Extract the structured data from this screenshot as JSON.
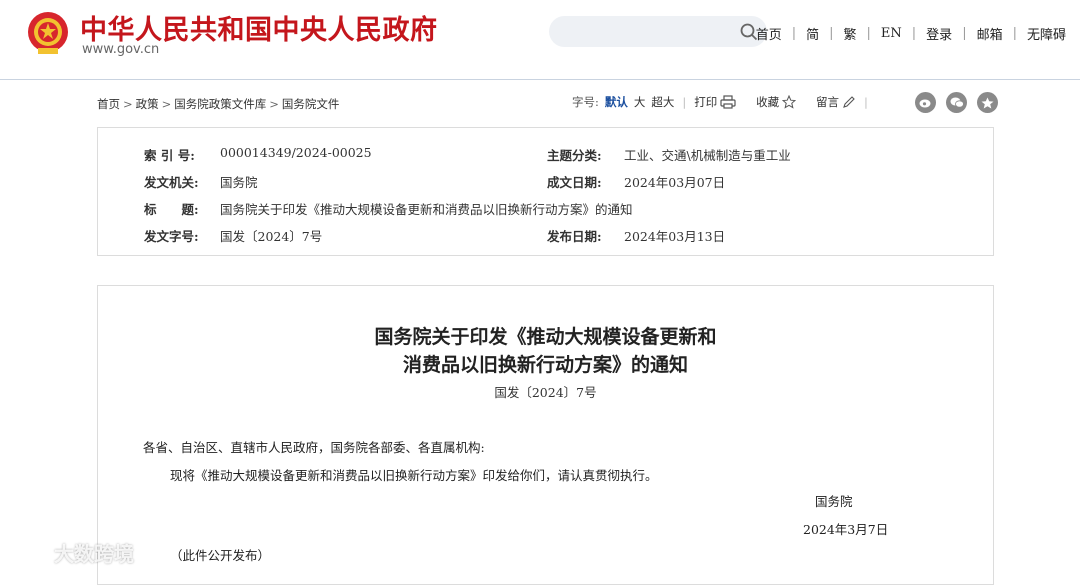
{
  "header": {
    "site_title": "中华人民共和国中央人民政府",
    "site_domain": "www.gov.cn",
    "search_placeholder": "",
    "nav": [
      {
        "label": "首页"
      },
      {
        "label": "简"
      },
      {
        "label": "繁"
      },
      {
        "label": "EN"
      },
      {
        "label": "登录"
      },
      {
        "label": "邮箱"
      },
      {
        "label": "无障碍"
      }
    ]
  },
  "breadcrumb": [
    "首页",
    "政策",
    "国务院政策文件库",
    "国务院文件"
  ],
  "tools": {
    "font_size_label": "字号:",
    "font_default": "默认",
    "font_large": "大",
    "font_xlarge": "超大",
    "print": "打印",
    "favorite": "收藏",
    "comment": "留言"
  },
  "share_icons": [
    "weibo-icon",
    "wechat-icon",
    "qzone-icon"
  ],
  "meta": {
    "index_label": "索 引 号:",
    "index_value": "000014349/2024-00025",
    "topic_label": "主题分类:",
    "topic_value": "工业、交通\\机械制造与重工业",
    "issuer_label": "发文机关:",
    "issuer_value": "国务院",
    "written_label": "成文日期:",
    "written_value": "2024年03月07日",
    "title_label": "标　　题:",
    "title_value": "国务院关于印发《推动大规模设备更新和消费品以旧换新行动方案》的通知",
    "docno_label": "发文字号:",
    "docno_value": "国发〔2024〕7号",
    "published_label": "发布日期:",
    "published_value": "2024年03月13日"
  },
  "document": {
    "title_line1": "国务院关于印发《推动大规模设备更新和",
    "title_line2": "消费品以旧换新行动方案》的通知",
    "number": "国发〔2024〕7号",
    "salutation": "各省、自治区、直辖市人民政府，国务院各部委、各直属机构:",
    "body": "现将《推动大规模设备更新和消费品以旧换新行动方案》印发给你们，请认真贯彻执行。",
    "signer": "国务院",
    "date": "2024年3月7日",
    "note": "（此件公开发布）"
  },
  "watermark": "大数跨境",
  "colors": {
    "brand_red": "#c4161c",
    "link_blue": "#1a4e9e"
  }
}
